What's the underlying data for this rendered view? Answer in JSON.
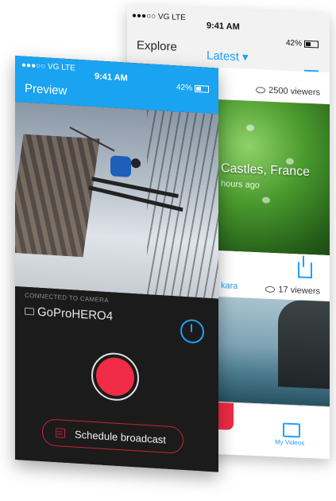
{
  "back_screen": {
    "status": {
      "carrier": "●●●○○ VG  LTE",
      "time": "9:41 AM",
      "battery": "42%"
    },
    "nav": {
      "title": "Explore",
      "dropdown": "Latest ▾"
    },
    "card1": {
      "viewers": "2500 viewers",
      "caption": "Castles, France",
      "subtitle": "hours ago"
    },
    "card2": {
      "user_fragment": "kara",
      "viewers": "17 viewers"
    },
    "tabbar": {
      "my_videos": "My Videos"
    }
  },
  "front_screen": {
    "status": {
      "carrier": "●●●○○ VG  LTE",
      "time": "9:41 AM",
      "battery": "42%"
    },
    "header": {
      "title": "Preview"
    },
    "controls": {
      "connected_label": "CONNECTED TO CAMERA",
      "camera_name": "GoProHERO4",
      "schedule_label": "Schedule broadcast"
    }
  },
  "colors": {
    "accent": "#1aa3f0",
    "record": "#ef2b45",
    "dark_bg": "#1b1b1b"
  }
}
